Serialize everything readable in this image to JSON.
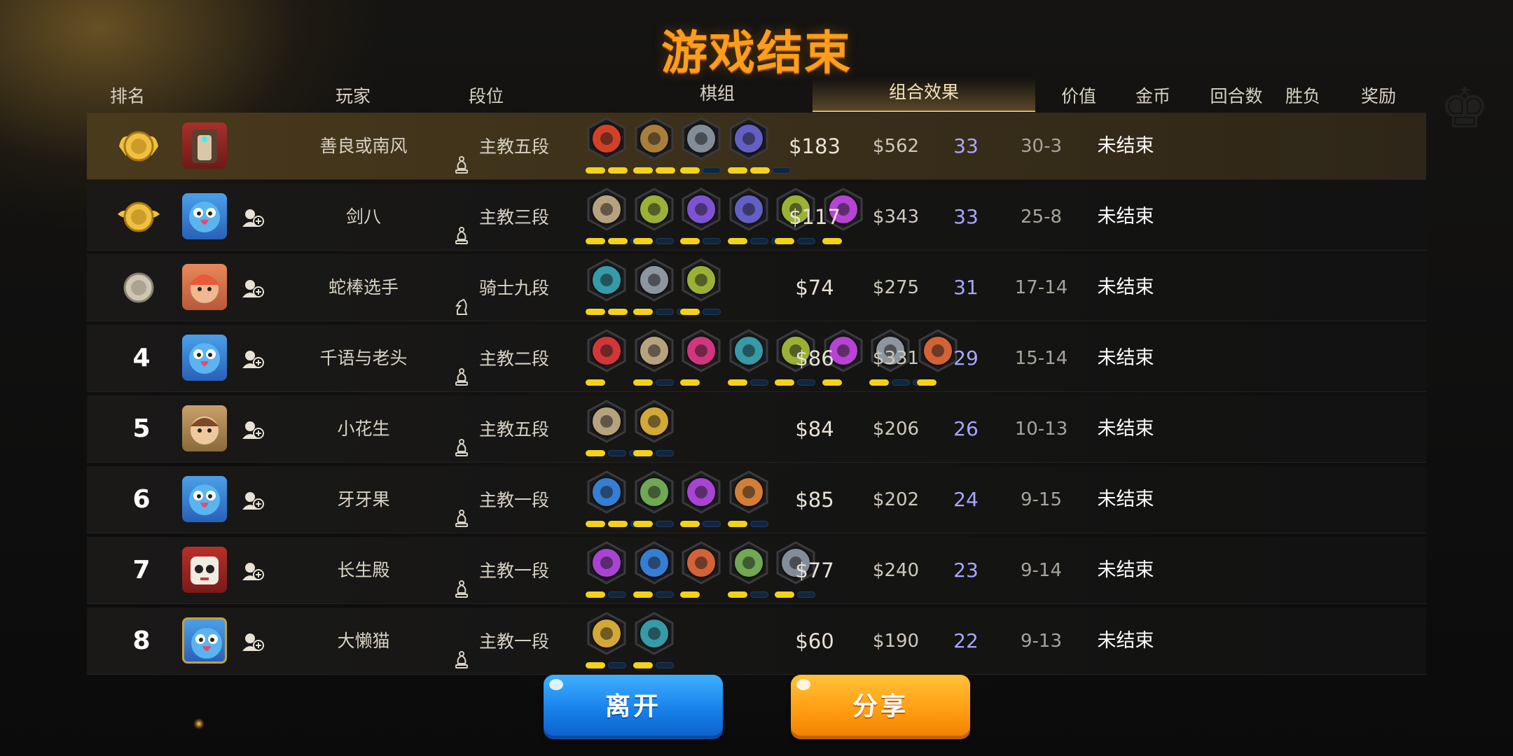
{
  "title": "游戏结束",
  "header": {
    "rank": "排名",
    "player": "玩家",
    "tier": "段位",
    "pieces": "棋组",
    "synergy_tab": "组合效果",
    "value": "价值",
    "gold": "金币",
    "rounds": "回合数",
    "win_loss": "胜负",
    "reward": "奖励"
  },
  "rows": [
    {
      "rank": "1",
      "rank_display": "medal-gold",
      "avatar": "robot-avatar",
      "name": "善良或南风",
      "tier_icon": "bishop-icon",
      "tier": "主教五段",
      "synergies": [
        {
          "icon": "demon-icon",
          "color": "#e8452a"
        },
        {
          "icon": "gear-icon",
          "color": "#b88a3e"
        },
        {
          "icon": "troll-icon",
          "color": "#8e9aa6"
        },
        {
          "icon": "mech-icon",
          "color": "#6a68d8"
        }
      ],
      "bars": [
        [
          1,
          1
        ],
        [
          1,
          1
        ],
        [
          1,
          0
        ],
        [
          1,
          1,
          0
        ]
      ],
      "value": "$183",
      "gold": "$562",
      "rounds": "33",
      "wl": "30-3",
      "reward": "未结束"
    },
    {
      "rank": "2",
      "rank_display": "medal-gold-wings",
      "avatar": "bird-avatar",
      "name": "剑八",
      "tier_icon": "bishop-icon",
      "tier": "主教三段",
      "synergies": [
        {
          "icon": "axe-icon",
          "color": "#c8b38a"
        },
        {
          "icon": "elf-icon",
          "color": "#a8c23a"
        },
        {
          "icon": "fish-icon",
          "color": "#8a5ae8"
        },
        {
          "icon": "mech-icon",
          "color": "#6a68d8"
        },
        {
          "icon": "beast-icon",
          "color": "#a8c23a"
        },
        {
          "icon": "demon-face-icon",
          "color": "#c848e8"
        }
      ],
      "bars": [
        [
          1,
          1,
          0
        ],
        [
          1,
          0
        ],
        [
          1,
          0
        ],
        [
          1,
          0,
          0
        ],
        [
          1,
          0
        ],
        [
          1
        ]
      ],
      "value": "$117",
      "gold": "$343",
      "rounds": "33",
      "wl": "25-8",
      "reward": "未结束"
    },
    {
      "rank": "3",
      "rank_display": "medal-silver",
      "avatar": "girl-avatar",
      "name": "蛇棒选手",
      "tier_icon": "knight-icon",
      "tier": "骑士九段",
      "synergies": [
        {
          "icon": "mystery-icon",
          "color": "#3aa8b8"
        },
        {
          "icon": "human-icon",
          "color": "#9aa4ae"
        },
        {
          "icon": "elf-icon",
          "color": "#a8c23a"
        }
      ],
      "bars": [
        [
          1,
          1
        ],
        [
          1,
          0,
          0
        ],
        [
          1,
          0
        ]
      ],
      "value": "$74",
      "gold": "$275",
      "rounds": "31",
      "wl": "17-14",
      "reward": "未结束"
    },
    {
      "rank": "4",
      "rank_display": "number",
      "avatar": "bird-avatar",
      "name": "千语与老头",
      "tier_icon": "bishop-icon",
      "tier": "主教二段",
      "synergies": [
        {
          "icon": "arch-icon",
          "color": "#e83a3a"
        },
        {
          "icon": "axe-icon",
          "color": "#c8b38a"
        },
        {
          "icon": "dragon-icon",
          "color": "#e83a8a"
        },
        {
          "icon": "mystery-icon",
          "color": "#3aa8b8"
        },
        {
          "icon": "elf-icon",
          "color": "#a8c23a"
        },
        {
          "icon": "demon-face-icon",
          "color": "#c848e8"
        },
        {
          "icon": "human-icon",
          "color": "#9aa4ae"
        },
        {
          "icon": "horned-icon",
          "color": "#e86a3a"
        }
      ],
      "bars": [
        [
          1
        ],
        [
          1,
          0
        ],
        [
          1
        ],
        [
          1,
          0
        ],
        [
          1,
          0
        ],
        [
          1
        ],
        [
          1,
          0,
          0
        ],
        [
          1
        ]
      ],
      "value": "$86",
      "gold": "$331",
      "rounds": "29",
      "wl": "15-14",
      "reward": "未结束"
    },
    {
      "rank": "5",
      "rank_display": "number",
      "avatar": "kid-avatar",
      "name": "小花生",
      "tier_icon": "bishop-icon",
      "tier": "主教五段",
      "synergies": [
        {
          "icon": "axe-icon",
          "color": "#c8b38a"
        },
        {
          "icon": "god-icon",
          "color": "#e8b83a"
        }
      ],
      "bars": [
        [
          1,
          0,
          0
        ],
        [
          1,
          0
        ]
      ],
      "value": "$84",
      "gold": "$206",
      "rounds": "26",
      "wl": "10-13",
      "reward": "未结束"
    },
    {
      "rank": "6",
      "rank_display": "number",
      "avatar": "bird-avatar",
      "name": "牙牙果",
      "tier_icon": "bishop-icon",
      "tier": "主教一段",
      "synergies": [
        {
          "icon": "feather-icon",
          "color": "#3a8ae8"
        },
        {
          "icon": "bow-icon",
          "color": "#7ab85a"
        },
        {
          "icon": "assassin-icon",
          "color": "#b848e8"
        },
        {
          "icon": "leaf-icon",
          "color": "#e88a3a"
        }
      ],
      "bars": [
        [
          1,
          1,
          0
        ],
        [
          1,
          0
        ],
        [
          1,
          0
        ],
        [
          1,
          0
        ]
      ],
      "value": "$85",
      "gold": "$202",
      "rounds": "24",
      "wl": "9-15",
      "reward": "未结束"
    },
    {
      "rank": "7",
      "rank_display": "number",
      "avatar": "skull-avatar",
      "name": "长生殿",
      "tier_icon": "bishop-icon",
      "tier": "主教一段",
      "synergies": [
        {
          "icon": "assassin-icon",
          "color": "#b848e8"
        },
        {
          "icon": "feather-icon",
          "color": "#3a8ae8"
        },
        {
          "icon": "horned-icon",
          "color": "#e86a3a"
        },
        {
          "icon": "bow-icon",
          "color": "#7ab85a"
        },
        {
          "icon": "troll-icon",
          "color": "#8e9aa6"
        }
      ],
      "bars": [
        [
          1,
          0
        ],
        [
          1,
          0
        ],
        [
          1
        ],
        [
          1,
          0
        ],
        [
          1,
          0
        ]
      ],
      "value": "$77",
      "gold": "$240",
      "rounds": "23",
      "wl": "9-14",
      "reward": "未结束"
    },
    {
      "rank": "8",
      "rank_display": "number",
      "avatar": "bird-frame-avatar",
      "name": "大懒猫",
      "tier_icon": "bishop-icon",
      "tier": "主教一段",
      "synergies": [
        {
          "icon": "god-icon",
          "color": "#e8b83a"
        },
        {
          "icon": "mystery-icon",
          "color": "#3aa8b8"
        }
      ],
      "bars": [
        [
          1,
          0
        ],
        [
          1,
          0
        ]
      ],
      "value": "$60",
      "gold": "$190",
      "rounds": "22",
      "wl": "9-13",
      "reward": "未结束"
    }
  ],
  "buttons": {
    "leave": "离开",
    "share": "分享"
  },
  "colors": {
    "title": "#ff9d1c",
    "rounds": "#a8a6ff",
    "bar_on": "#f4d21a",
    "leave_btn": "#1780ea",
    "share_btn": "#ff9e12"
  }
}
